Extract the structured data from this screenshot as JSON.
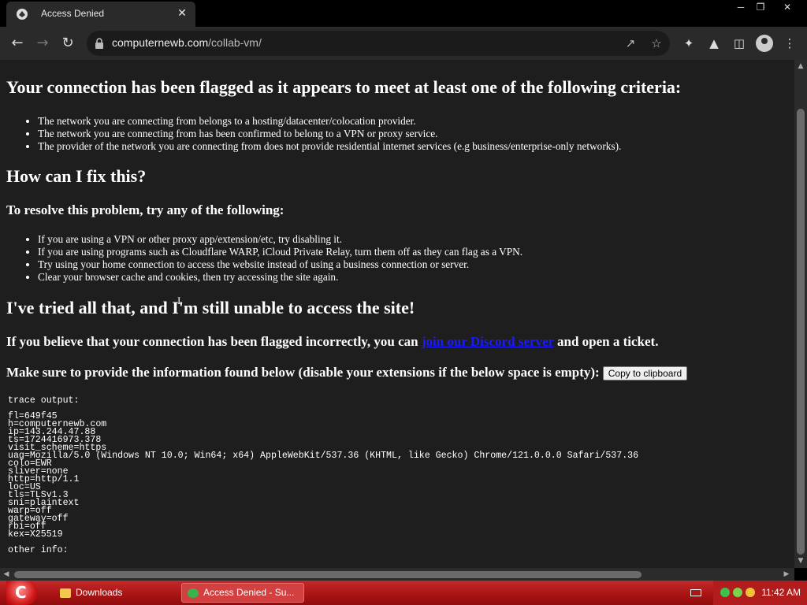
{
  "window": {
    "tab_title": "Access Denied",
    "tab_close": "✕",
    "minimize": "─",
    "restore": "❐",
    "close": "✕"
  },
  "toolbar": {
    "url_host": "computernewb.com",
    "url_path": "/collab-vm/"
  },
  "content": {
    "heading1": "Your connection has been flagged as it appears to meet at least one of the following criteria:",
    "criteria": [
      "The network you are connecting from belongs to a hosting/datacenter/colocation provider.",
      "The network you are connecting from has been confirmed to belong to a VPN or proxy service.",
      "The provider of the network you are connecting from does not provide residential internet services (e.g business/enterprise-only networks)."
    ],
    "heading2": "How can I fix this?",
    "heading3": "To resolve this problem, try any of the following:",
    "fixes": [
      "If you are using a VPN or other proxy app/extension/etc, try disabling it.",
      "If you are using programs such as Cloudflare WARP, iCloud Private Relay, turn them off as they can flag as a VPN.",
      "Try using your home connection to access the website instead of using a business connection or server.",
      "Clear your browser cache and cookies, then try accessing the site again."
    ],
    "heading4": "I've tried all that, and I'm still unable to access the site!",
    "ticket_before": "If you believe that your connection has been flagged incorrectly, you can ",
    "ticket_link": "join our Discord server",
    "ticket_after": " and open a ticket.",
    "info_text": "Make sure to provide the information found below (disable your extensions if the below space is empty):",
    "copy_button": "Copy to clipboard",
    "trace": "trace output:\n\nfl=649f45\nh=computernewb.com\nip=143.244.47.88\nts=1724416973.378\nvisit_scheme=https\nuag=Mozilla/5.0 (Windows NT 10.0; Win64; x64) AppleWebKit/537.36 (KHTML, like Gecko) Chrome/121.0.0.0 Safari/537.36\ncolo=EWR\nsliver=none\nhttp=http/1.1\nloc=US\ntls=TLSv1.3\nsni=plaintext\nwarp=off\ngateway=off\nrbi=off\nkex=X25519\n\nother info:"
  },
  "taskbar": {
    "items": [
      {
        "label": "Downloads"
      },
      {
        "label": "Access Denied - Su..."
      }
    ],
    "clock": "11:42 AM"
  },
  "colors": {
    "page_bg": "#1e1e1e",
    "link": "#1a1aff",
    "taskbar": "#a71313"
  }
}
